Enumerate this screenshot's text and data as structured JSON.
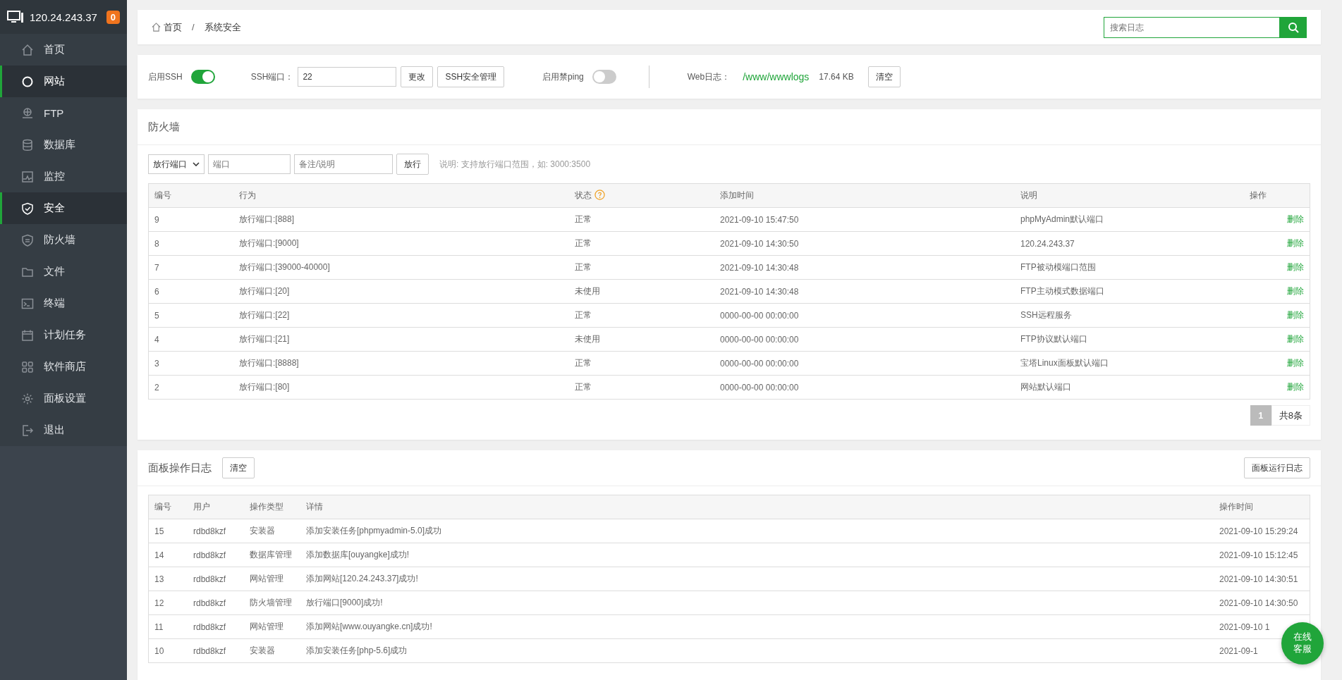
{
  "sidebar": {
    "host": "120.24.243.37",
    "badge": "0",
    "items": [
      {
        "label": "首页",
        "selected": false
      },
      {
        "label": "网站",
        "selected": true
      },
      {
        "label": "FTP",
        "selected": false
      },
      {
        "label": "数据库",
        "selected": false
      },
      {
        "label": "监控",
        "selected": false
      },
      {
        "label": "安全",
        "selected": true
      },
      {
        "label": "防火墙",
        "selected": false
      },
      {
        "label": "文件",
        "selected": false
      },
      {
        "label": "终端",
        "selected": false
      },
      {
        "label": "计划任务",
        "selected": false
      },
      {
        "label": "软件商店",
        "selected": false
      },
      {
        "label": "面板设置",
        "selected": false
      },
      {
        "label": "退出",
        "selected": false
      }
    ]
  },
  "breadcrumb": {
    "items": [
      "首页",
      "系统安全"
    ],
    "separator": "/"
  },
  "search": {
    "placeholder": "搜索日志"
  },
  "ssh_bar": {
    "ssh_label": "启用SSH",
    "ssh_on": true,
    "port_label": "SSH端口：",
    "port_value": "22",
    "change_button": "更改",
    "manage_button": "SSH安全管理",
    "ping_label": "启用禁ping",
    "ping_on": false,
    "weblog_label": "Web日志：",
    "weblog_path": "/www/wwwlogs",
    "weblog_size": "17.64 KB",
    "clear_button": "清空"
  },
  "firewall": {
    "title": "防火墙",
    "select_value": "放行端口",
    "port_placeholder": "端口",
    "note_placeholder": "备注/说明",
    "add_button": "放行",
    "hint": "说明: 支持放行端口范围，如: 3000:3500",
    "columns": [
      "编号",
      "行为",
      "状态",
      "添加时间",
      "说明",
      "操作"
    ],
    "rows": [
      {
        "id": "9",
        "action": "放行端口:[888]",
        "status": "正常",
        "time": "2021-09-10 15:47:50",
        "note": "phpMyAdmin默认端口",
        "op": "删除"
      },
      {
        "id": "8",
        "action": "放行端口:[9000]",
        "status": "正常",
        "time": "2021-09-10 14:30:50",
        "note": "120.24.243.37",
        "op": "删除"
      },
      {
        "id": "7",
        "action": "放行端口:[39000-40000]",
        "status": "正常",
        "time": "2021-09-10 14:30:48",
        "note": "FTP被动模端口范围",
        "op": "删除"
      },
      {
        "id": "6",
        "action": "放行端口:[20]",
        "status": "未使用",
        "time": "2021-09-10 14:30:48",
        "note": "FTP主动模式数据端口",
        "op": "删除"
      },
      {
        "id": "5",
        "action": "放行端口:[22]",
        "status": "正常",
        "time": "0000-00-00 00:00:00",
        "note": "SSH远程服务",
        "op": "删除"
      },
      {
        "id": "4",
        "action": "放行端口:[21]",
        "status": "未使用",
        "time": "0000-00-00 00:00:00",
        "note": "FTP协议默认端口",
        "op": "删除"
      },
      {
        "id": "3",
        "action": "放行端口:[8888]",
        "status": "正常",
        "time": "0000-00-00 00:00:00",
        "note": "宝塔Linux面板默认端口",
        "op": "删除"
      },
      {
        "id": "2",
        "action": "放行端口:[80]",
        "status": "正常",
        "time": "0000-00-00 00:00:00",
        "note": "网站默认端口",
        "op": "删除"
      }
    ],
    "pages": [
      {
        "label": "1",
        "selected": true
      }
    ],
    "total": "共8条"
  },
  "log": {
    "title": "面板操作日志",
    "clear_button": "清空",
    "run_log_button": "面板运行日志",
    "columns": [
      "编号",
      "用户",
      "操作类型",
      "详情",
      "操作时间"
    ],
    "rows": [
      {
        "id": "15",
        "user": "rdbd8kzf",
        "type": "安装器",
        "detail": "添加安装任务[phpmyadmin-5.0]成功",
        "time": "2021-09-10 15:29:24"
      },
      {
        "id": "14",
        "user": "rdbd8kzf",
        "type": "数据库管理",
        "detail": "添加数据库[ouyangke]成功!",
        "time": "2021-09-10 15:12:45"
      },
      {
        "id": "13",
        "user": "rdbd8kzf",
        "type": "网站管理",
        "detail": "添加网站[120.24.243.37]成功!",
        "time": "2021-09-10 14:30:51"
      },
      {
        "id": "12",
        "user": "rdbd8kzf",
        "type": "防火墙管理",
        "detail": "放行端口[9000]成功!",
        "time": "2021-09-10 14:30:50"
      },
      {
        "id": "11",
        "user": "rdbd8kzf",
        "type": "网站管理",
        "detail": "添加网站[www.ouyangke.cn]成功!",
        "time": "2021-09-10 1"
      },
      {
        "id": "10",
        "user": "rdbd8kzf",
        "type": "安装器",
        "detail": "添加安装任务[php-5.6]成功",
        "time": "2021-09-1"
      }
    ]
  },
  "chat_button": "在线客服"
}
